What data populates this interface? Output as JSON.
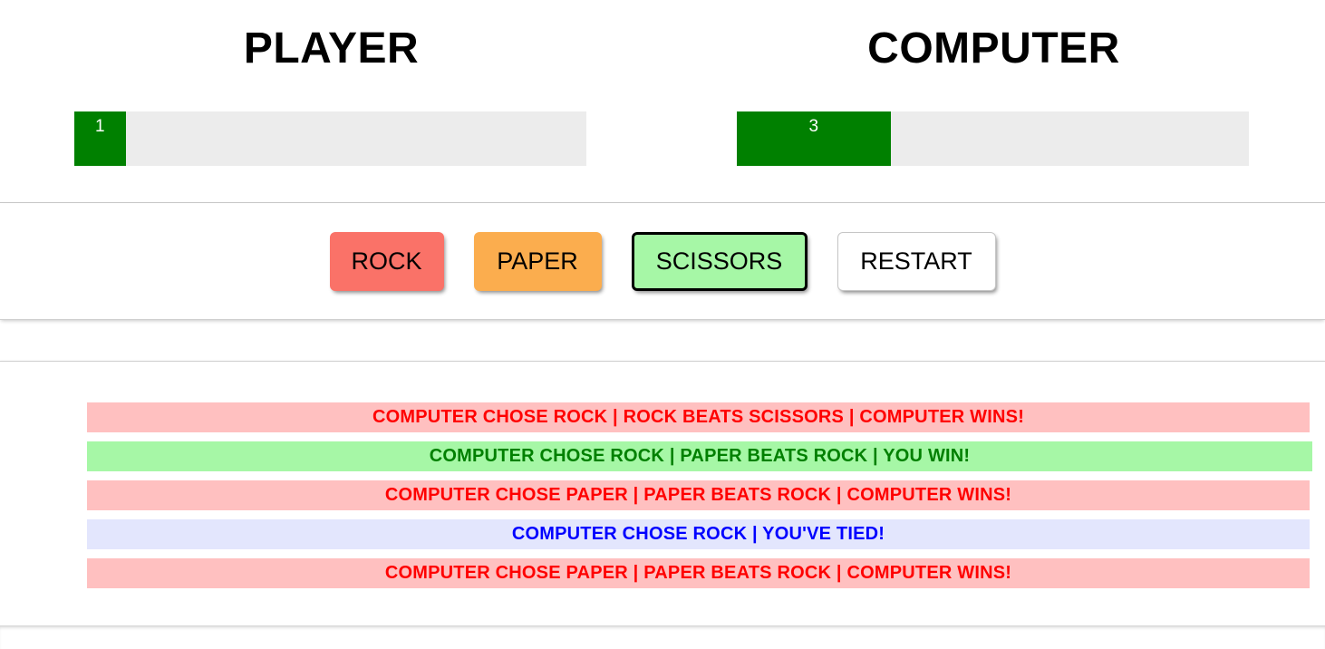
{
  "scoreboard": {
    "player": {
      "title": "PLAYER",
      "score": "1",
      "fill_percent": 10
    },
    "computer": {
      "title": "COMPUTER",
      "score": "3",
      "fill_percent": 30
    },
    "bar_fill_color": "#008000",
    "bar_track_color": "#ececec"
  },
  "controls": {
    "rock_label": "ROCK",
    "paper_label": "PAPER",
    "scissors_label": "SCISSORS",
    "restart_label": "RESTART",
    "rock_color": "#fa7268",
    "paper_color": "#fbad4e",
    "scissors_color": "#a6f7a6",
    "restart_color": "#ffffff",
    "selected": "SCISSORS"
  },
  "log": {
    "rows": [
      {
        "text": "COMPUTER CHOSE ROCK | ROCK BEATS SCISSORS | COMPUTER WINS!",
        "outcome": "lose"
      },
      {
        "text": "COMPUTER CHOSE ROCK | PAPER BEATS ROCK | YOU WIN!",
        "outcome": "win"
      },
      {
        "text": "COMPUTER CHOSE PAPER | PAPER BEATS ROCK | COMPUTER WINS!",
        "outcome": "lose"
      },
      {
        "text": "COMPUTER CHOSE ROCK | YOU'VE TIED!",
        "outcome": "tie"
      },
      {
        "text": "COMPUTER CHOSE PAPER | PAPER BEATS ROCK | COMPUTER WINS!",
        "outcome": "lose"
      }
    ],
    "colors": {
      "lose_bg": "#ffc0c0",
      "lose_text": "#ff0000",
      "win_bg": "#a6f7a6",
      "win_text": "#008000",
      "tie_bg": "#e3e6fd",
      "tie_text": "#0000ff"
    }
  }
}
